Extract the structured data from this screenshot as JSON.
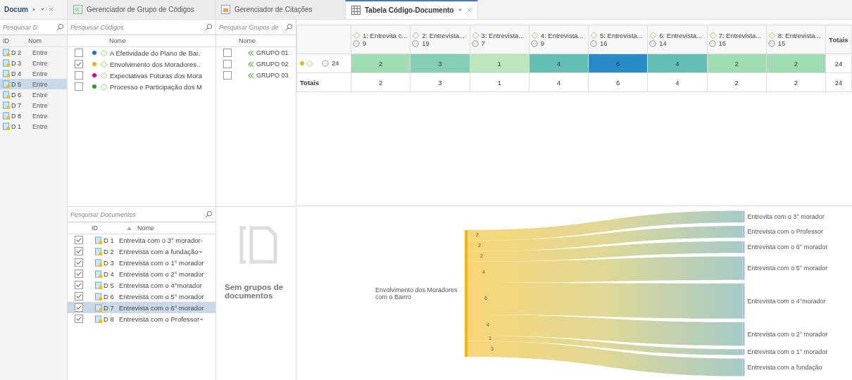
{
  "tabs": [
    {
      "label": "Docum",
      "kind": "panel"
    },
    {
      "label": "Gerenciador de Grupo de Códigos",
      "kind": "codegroups",
      "selected": false
    },
    {
      "label": "Gerenciador de Citações",
      "kind": "quotes",
      "selected": false
    },
    {
      "label": "Tabela Código-Documento",
      "kind": "table",
      "selected": true
    }
  ],
  "documents_panel": {
    "search": {
      "placeholder": "Pesquisar D"
    },
    "columns": [
      "ID",
      "Nom"
    ],
    "rows": [
      {
        "id": "D 2",
        "name": "Entre",
        "selected": false
      },
      {
        "id": "D 3",
        "name": "Entre",
        "selected": false
      },
      {
        "id": "D 4",
        "name": "Entre",
        "selected": false
      },
      {
        "id": "D 5",
        "name": "Entre",
        "selected": true
      },
      {
        "id": "D 6",
        "name": "Entre",
        "selected": false
      },
      {
        "id": "D 7",
        "name": "Entre",
        "selected": false
      },
      {
        "id": "D 8",
        "name": "Entre",
        "selected": false
      },
      {
        "id": "D 1",
        "name": "Entre",
        "selected": false
      }
    ]
  },
  "codes": {
    "search": {
      "placeholder": "Pesquisar Códigos"
    },
    "column": "Nome",
    "rows": [
      {
        "name": "A Efetividade do Plano de Bai.",
        "color": "#1a6fe0",
        "checked": false
      },
      {
        "name": "Envolvimento dos Moradores..",
        "color": "#f5b400",
        "checked": true
      },
      {
        "name": "Expectativas Futuras dos Mora",
        "color": "#e5007a",
        "checked": false
      },
      {
        "name": "Processo e Participação dos M",
        "color": "#2e9a2e",
        "checked": false
      }
    ]
  },
  "code_groups": {
    "search": {
      "placeholder": "Pesquisar Grupos de"
    },
    "column": "Nome",
    "rows": [
      {
        "name": "GRUPO 01",
        "checked": false
      },
      {
        "name": "GRUPO 02",
        "checked": false
      },
      {
        "name": "GRUPO 03",
        "checked": false
      }
    ]
  },
  "document_filter": {
    "search": {
      "placeholder": "Pesquisar Documentos"
    },
    "columns": [
      "ID",
      "Nome"
    ],
    "rows": [
      {
        "id": "D 1",
        "name": "Entrevita com o 3° morador-",
        "checked": true,
        "selected": false
      },
      {
        "id": "D 2",
        "name": "Entrevista com a fundação~",
        "checked": true,
        "selected": false
      },
      {
        "id": "D 3",
        "name": "Entrevista com o 1° morador",
        "checked": true,
        "selected": false
      },
      {
        "id": "D 4",
        "name": "Entrevista com o 2° morador",
        "checked": true,
        "selected": false
      },
      {
        "id": "D 5",
        "name": "Entrevista com o 4°morador",
        "checked": true,
        "selected": false
      },
      {
        "id": "D 6",
        "name": "Entrevista com o 5° morador",
        "checked": true,
        "selected": false
      },
      {
        "id": "D 7",
        "name": "Entrevista com o 6° morador",
        "checked": true,
        "selected": true
      },
      {
        "id": "D 8",
        "name": "Entrevista com o Professor~",
        "checked": true,
        "selected": false
      }
    ]
  },
  "document_groups": {
    "empty_message": "Sem grupos de documentos"
  },
  "table": {
    "columns": [
      {
        "name": "1: Entrevita c...",
        "count": "9"
      },
      {
        "name": "2: Entrevista...",
        "count": "19"
      },
      {
        "name": "3: Entrevista...",
        "count": "7"
      },
      {
        "name": "4: Entrevista...",
        "count": "9"
      },
      {
        "name": "5: Entrevista...",
        "count": "16"
      },
      {
        "name": "6: Entrevista...",
        "count": "14"
      },
      {
        "name": "7: Entrevista...",
        "count": "16"
      },
      {
        "name": "8: Entrevista...",
        "count": "15"
      }
    ],
    "totals_header": "Totais",
    "rows": [
      {
        "color": "#f5b400",
        "count": "24",
        "values": [
          "2",
          "3",
          "1",
          "4",
          "6",
          "4",
          "2",
          "2"
        ],
        "total": "24"
      }
    ],
    "totals_row": {
      "label": "Totais",
      "values": [
        "2",
        "3",
        "1",
        "4",
        "6",
        "4",
        "2",
        "2"
      ],
      "total": "24"
    }
  },
  "sankey": {
    "source": "Envolvimento dos Moradores com o Bairro",
    "flows": [
      {
        "target": "Entrevita com o 3° morador",
        "value": "2"
      },
      {
        "target": "Entrevista com o Professor",
        "value": "2"
      },
      {
        "target": "Entrevista com o 6° morador",
        "value": "2"
      },
      {
        "target": "Entrevista com o 5° morador",
        "value": "4"
      },
      {
        "target": "Entrevista com o 4°morador",
        "value": "6"
      },
      {
        "target": "Entrevista com o 2° morador",
        "value": "4"
      },
      {
        "target": "Entrevista com o 1° morador",
        "value": "1"
      },
      {
        "target": "Entrevista com a fundação",
        "value": "3"
      }
    ]
  }
}
